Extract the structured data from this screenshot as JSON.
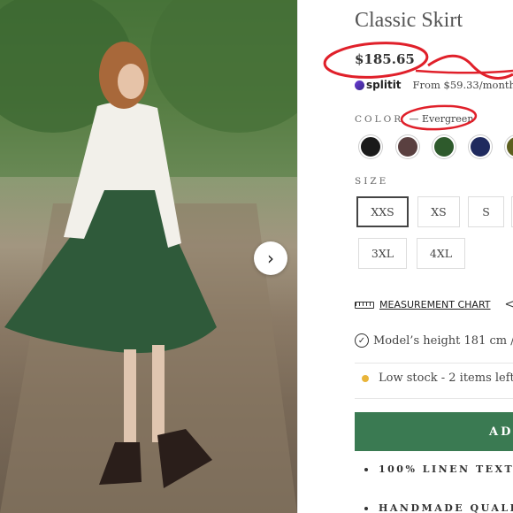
{
  "product": {
    "title": "Classic Skirt",
    "price": "$185.65"
  },
  "splitit": {
    "logo": "splitit",
    "installment_text": "From $59.33/month"
  },
  "color": {
    "label": "COLOR",
    "selected": "— Evergreen",
    "swatches": [
      {
        "name": "black",
        "hex": "#1a1a1a"
      },
      {
        "name": "brown",
        "hex": "#5a4040"
      },
      {
        "name": "evergreen",
        "hex": "#2e5a2c"
      },
      {
        "name": "navy",
        "hex": "#1f2a5e"
      },
      {
        "name": "olive",
        "hex": "#5c5f1e"
      }
    ]
  },
  "size": {
    "label": "SIZE",
    "options": [
      "XXS",
      "XS",
      "S",
      "3XL",
      "4XL"
    ],
    "selected": "XXS"
  },
  "measurement": {
    "link_text": "MEASUREMENT CHART",
    "extra": "<"
  },
  "info": {
    "model_height": "Model’s height 181 cm /",
    "stock": "Low stock - 2 items left"
  },
  "cart": {
    "button_label": "AD"
  },
  "features": [
    "100% LINEN TEXTI",
    "HANDMADE QUALI"
  ],
  "gallery": {
    "next_icon": "›"
  },
  "colors": {
    "accent_green": "#3a7a52",
    "annotation_red": "#e0202a",
    "stock_dot": "#e9b53a"
  }
}
